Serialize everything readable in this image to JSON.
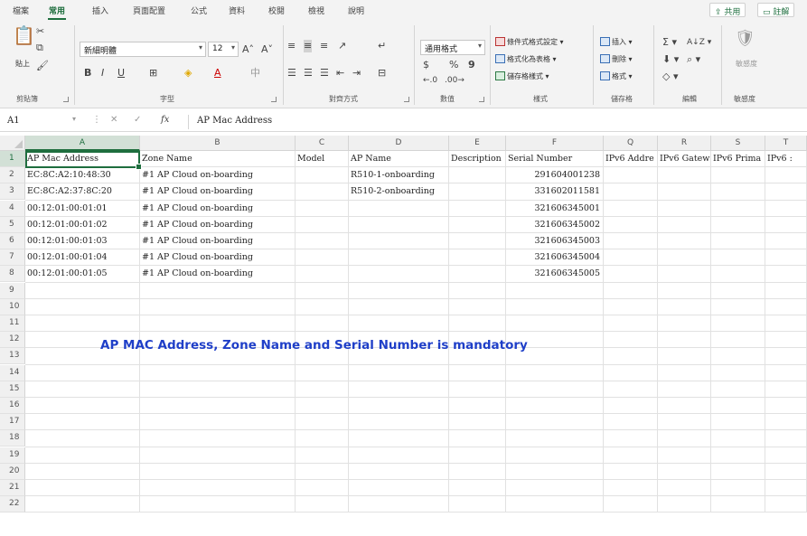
{
  "tabs": [
    "檔案",
    "常用",
    "插入",
    "頁面配置",
    "公式",
    "資料",
    "校閱",
    "檢視",
    "說明"
  ],
  "share_label": "共用",
  "comment_label": "註解",
  "ribbon": {
    "clipboard": {
      "paste": "貼上",
      "label": "剪貼簿"
    },
    "font": {
      "name": "新細明體",
      "size": "12",
      "label": "字型"
    },
    "alignment": {
      "label": "對齊方式"
    },
    "number": {
      "format": "通用格式",
      "currency": "$",
      "percent": "%",
      "comma": "9",
      "label": "數值"
    },
    "styles": {
      "conditional": "條件式格式設定",
      "as_table": "格式化為表格",
      "cell_styles": "儲存格樣式",
      "label": "樣式"
    },
    "cells": {
      "insert": "插入",
      "delete": "刪除",
      "format": "格式",
      "label": "儲存格"
    },
    "editing": {
      "label": "編輯"
    },
    "sensitivity": {
      "name": "敏感度",
      "label": "敏感度"
    }
  },
  "formula_bar": {
    "cell_ref": "A1",
    "fx": "fx",
    "value": "AP Mac Address"
  },
  "columns": [
    "A",
    "B",
    "C",
    "D",
    "E",
    "F",
    "Q",
    "R",
    "S",
    "T"
  ],
  "rows": [
    "1",
    "2",
    "3",
    "4",
    "5",
    "6",
    "7",
    "8",
    "9",
    "10",
    "11",
    "12",
    "13",
    "14",
    "15",
    "16",
    "17",
    "18",
    "19",
    "20",
    "21",
    "22"
  ],
  "headers": [
    "AP Mac Address",
    "Zone Name",
    "Model",
    "AP Name",
    "Description",
    "Serial Number",
    "IPv6 Addre",
    "IPv6 Gatew",
    "IPv6 Prima",
    "IPv6 :"
  ],
  "data_rows": [
    {
      "mac": "EC:8C:A2:10:48:30",
      "zone": "#1 AP Cloud on-boarding",
      "ap_name": "R510-1-onboarding",
      "serial": "291604001238"
    },
    {
      "mac": "EC:8C:A2:37:8C:20",
      "zone": "#1 AP Cloud on-boarding",
      "ap_name": "R510-2-onboarding",
      "serial": "331602011581"
    },
    {
      "mac": "00:12:01:00:01:01",
      "zone": "#1 AP Cloud on-boarding",
      "ap_name": "",
      "serial": "321606345001"
    },
    {
      "mac": "00:12:01:00:01:02",
      "zone": "#1 AP Cloud on-boarding",
      "ap_name": "",
      "serial": "321606345002"
    },
    {
      "mac": "00:12:01:00:01:03",
      "zone": "#1 AP Cloud on-boarding",
      "ap_name": "",
      "serial": "321606345003"
    },
    {
      "mac": "00:12:01:00:01:04",
      "zone": "#1 AP Cloud on-boarding",
      "ap_name": "",
      "serial": "321606345004"
    },
    {
      "mac": "00:12:01:00:01:05",
      "zone": "#1 AP Cloud on-boarding",
      "ap_name": "",
      "serial": "321606345005"
    }
  ],
  "annotation": "AP MAC Address, Zone Name and Serial Number is mandatory",
  "colors": {
    "accent": "#1e6e3e",
    "annotation": "#1f3fc8"
  }
}
